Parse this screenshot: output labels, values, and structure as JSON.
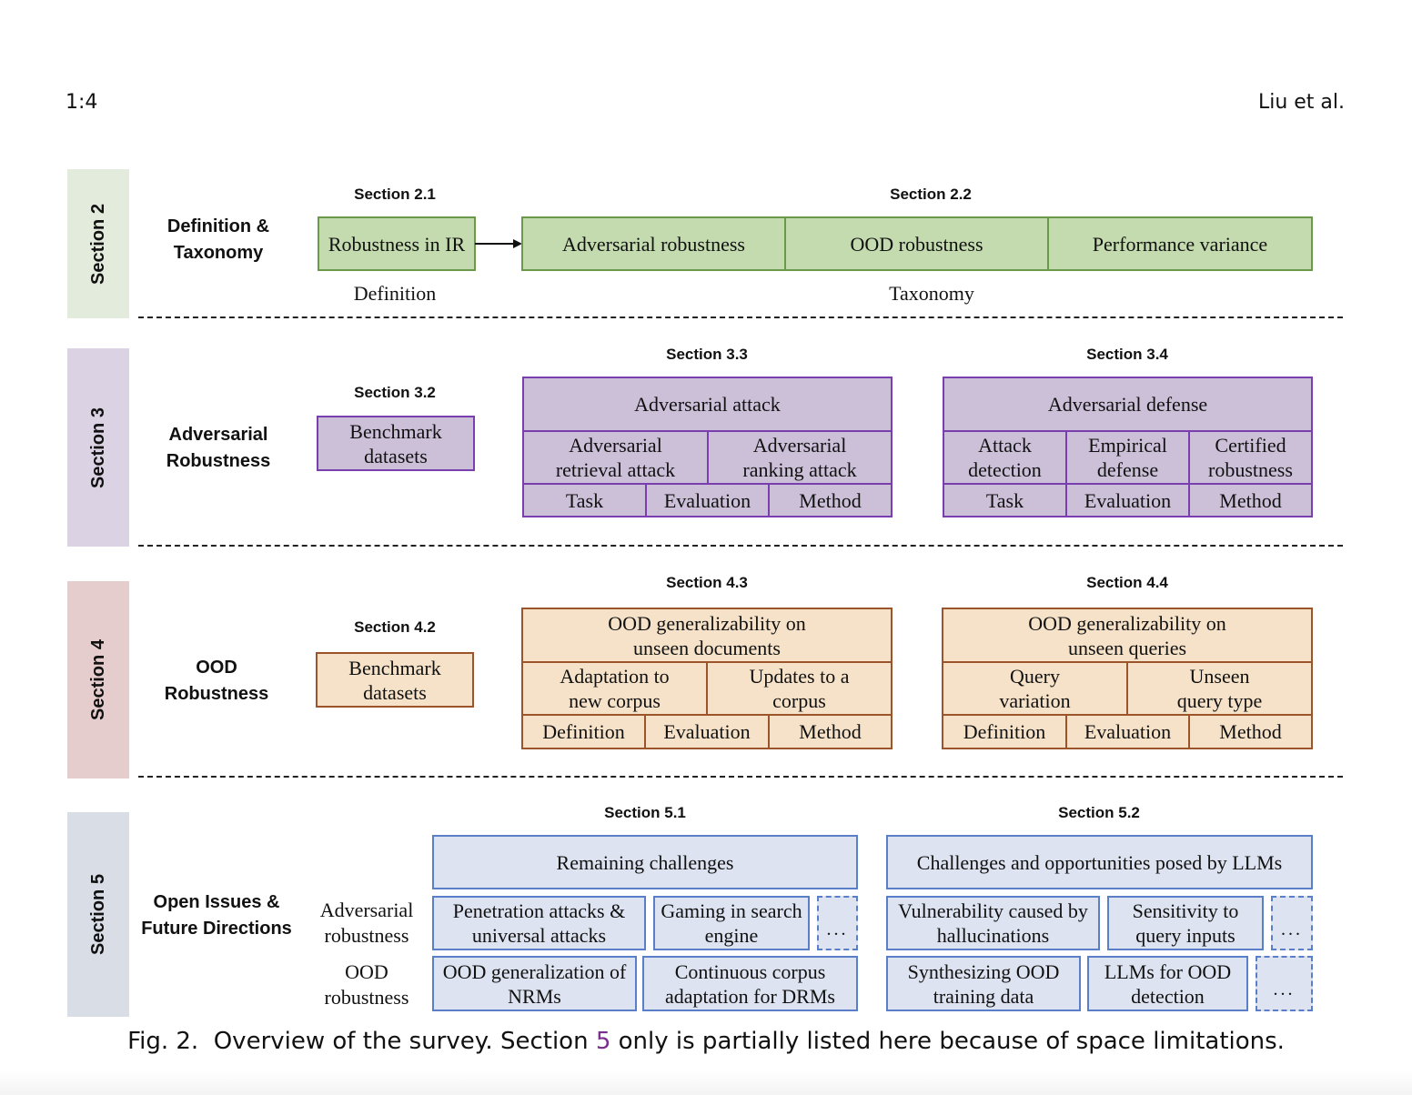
{
  "header": {
    "page_number": "1:4",
    "authors": "Liu et al."
  },
  "sections": [
    {
      "tab": "Section 2",
      "tab_color": "#e3ebdd",
      "category": [
        "Definition &",
        "Taxonomy"
      ],
      "subsections": [
        {
          "id": "Section 2.1",
          "caption": "Definition",
          "boxes": [
            "Robustness in IR"
          ]
        },
        {
          "id": "Section 2.2",
          "caption": "Taxonomy",
          "boxes": [
            "Adversarial robustness",
            "OOD robustness",
            "Performance variance"
          ]
        }
      ],
      "arrow": "2.1 → 2.2"
    },
    {
      "tab": "Section 3",
      "tab_color": "#dbd3e3",
      "category": [
        "Adversarial",
        "Robustness"
      ],
      "subsections": [
        {
          "id": "Section 3.2",
          "boxes": [
            "Benchmark datasets"
          ]
        },
        {
          "id": "Section 3.3",
          "title": "Adversarial attack",
          "middle": [
            "Adversarial retrieval attack",
            "Adversarial ranking attack"
          ],
          "bottom": [
            "Task",
            "Evaluation",
            "Method"
          ]
        },
        {
          "id": "Section 3.4",
          "title": "Adversarial defense",
          "middle": [
            "Attack detection",
            "Empirical defense",
            "Certified robustness"
          ],
          "bottom": [
            "Task",
            "Evaluation",
            "Method"
          ]
        }
      ]
    },
    {
      "tab": "Section 4",
      "tab_color": "#e6cdcd",
      "category": [
        "OOD",
        "Robustness"
      ],
      "subsections": [
        {
          "id": "Section 4.2",
          "boxes": [
            "Benchmark datasets"
          ]
        },
        {
          "id": "Section 4.3",
          "title": "OOD generalizability on unseen documents",
          "middle": [
            "Adaptation to new corpus",
            "Updates to a corpus"
          ],
          "bottom": [
            "Definition",
            "Evaluation",
            "Method"
          ]
        },
        {
          "id": "Section 4.4",
          "title": "OOD generalizability on unseen queries",
          "middle": [
            "Query variation",
            "Unseen query type"
          ],
          "bottom": [
            "Definition",
            "Evaluation",
            "Method"
          ]
        }
      ]
    },
    {
      "tab": "Section 5",
      "tab_color": "#d9dde6",
      "category": [
        "Open Issues &",
        "Future Directions"
      ],
      "row_labels": [
        "Adversarial robustness",
        "OOD robustness"
      ],
      "subsections": [
        {
          "id": "Section 5.1",
          "title": "Remaining challenges",
          "adversarial": [
            "Penetration attacks & universal attacks",
            "Gaming in search engine",
            "..."
          ],
          "ood": [
            "OOD generalization of NRMs",
            "Continuous corpus adaptation for DRMs"
          ]
        },
        {
          "id": "Section 5.2",
          "title": "Challenges and opportunities posed by LLMs",
          "adversarial": [
            "Vulnerability caused by hallucinations",
            "Sensitivity to query inputs",
            "..."
          ],
          "ood": [
            "Synthesizing OOD training data",
            "LLMs for OOD detection",
            "..."
          ]
        }
      ]
    }
  ],
  "caption": {
    "prefix": "Fig. 2.  Overview of the survey. Section ",
    "ref": "5",
    "suffix": " only is partially listed here because of space limitations.",
    "ref_color": "#7b2e8e"
  },
  "colors": {
    "green_fill": "#c3dbae",
    "green_border": "#6a9a49",
    "purple_fill": "#ccc0d9",
    "purple_border": "#7a3fae",
    "orange_fill": "#f6e2c8",
    "orange_border": "#9c552a",
    "blue_fill": "#dde3f0",
    "blue_border": "#5b7ec8"
  }
}
